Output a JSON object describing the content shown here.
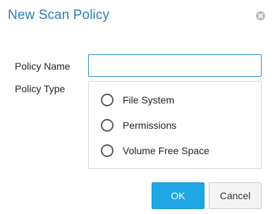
{
  "dialog": {
    "title": "New Scan Policy",
    "close_icon": "close-circle-icon"
  },
  "form": {
    "policy_name_label": "Policy Name",
    "policy_name_value": "",
    "policy_type_label": "Policy Type",
    "policy_type_options": [
      {
        "label": "File System",
        "selected": false
      },
      {
        "label": "Permissions",
        "selected": false
      },
      {
        "label": "Volume Free Space",
        "selected": false
      }
    ]
  },
  "buttons": {
    "ok_label": "OK",
    "cancel_label": "Cancel"
  },
  "colors": {
    "title": "#2a7fb0",
    "primary_button": "#1ea7e4",
    "input_focus_border": "#2a8fd1"
  }
}
